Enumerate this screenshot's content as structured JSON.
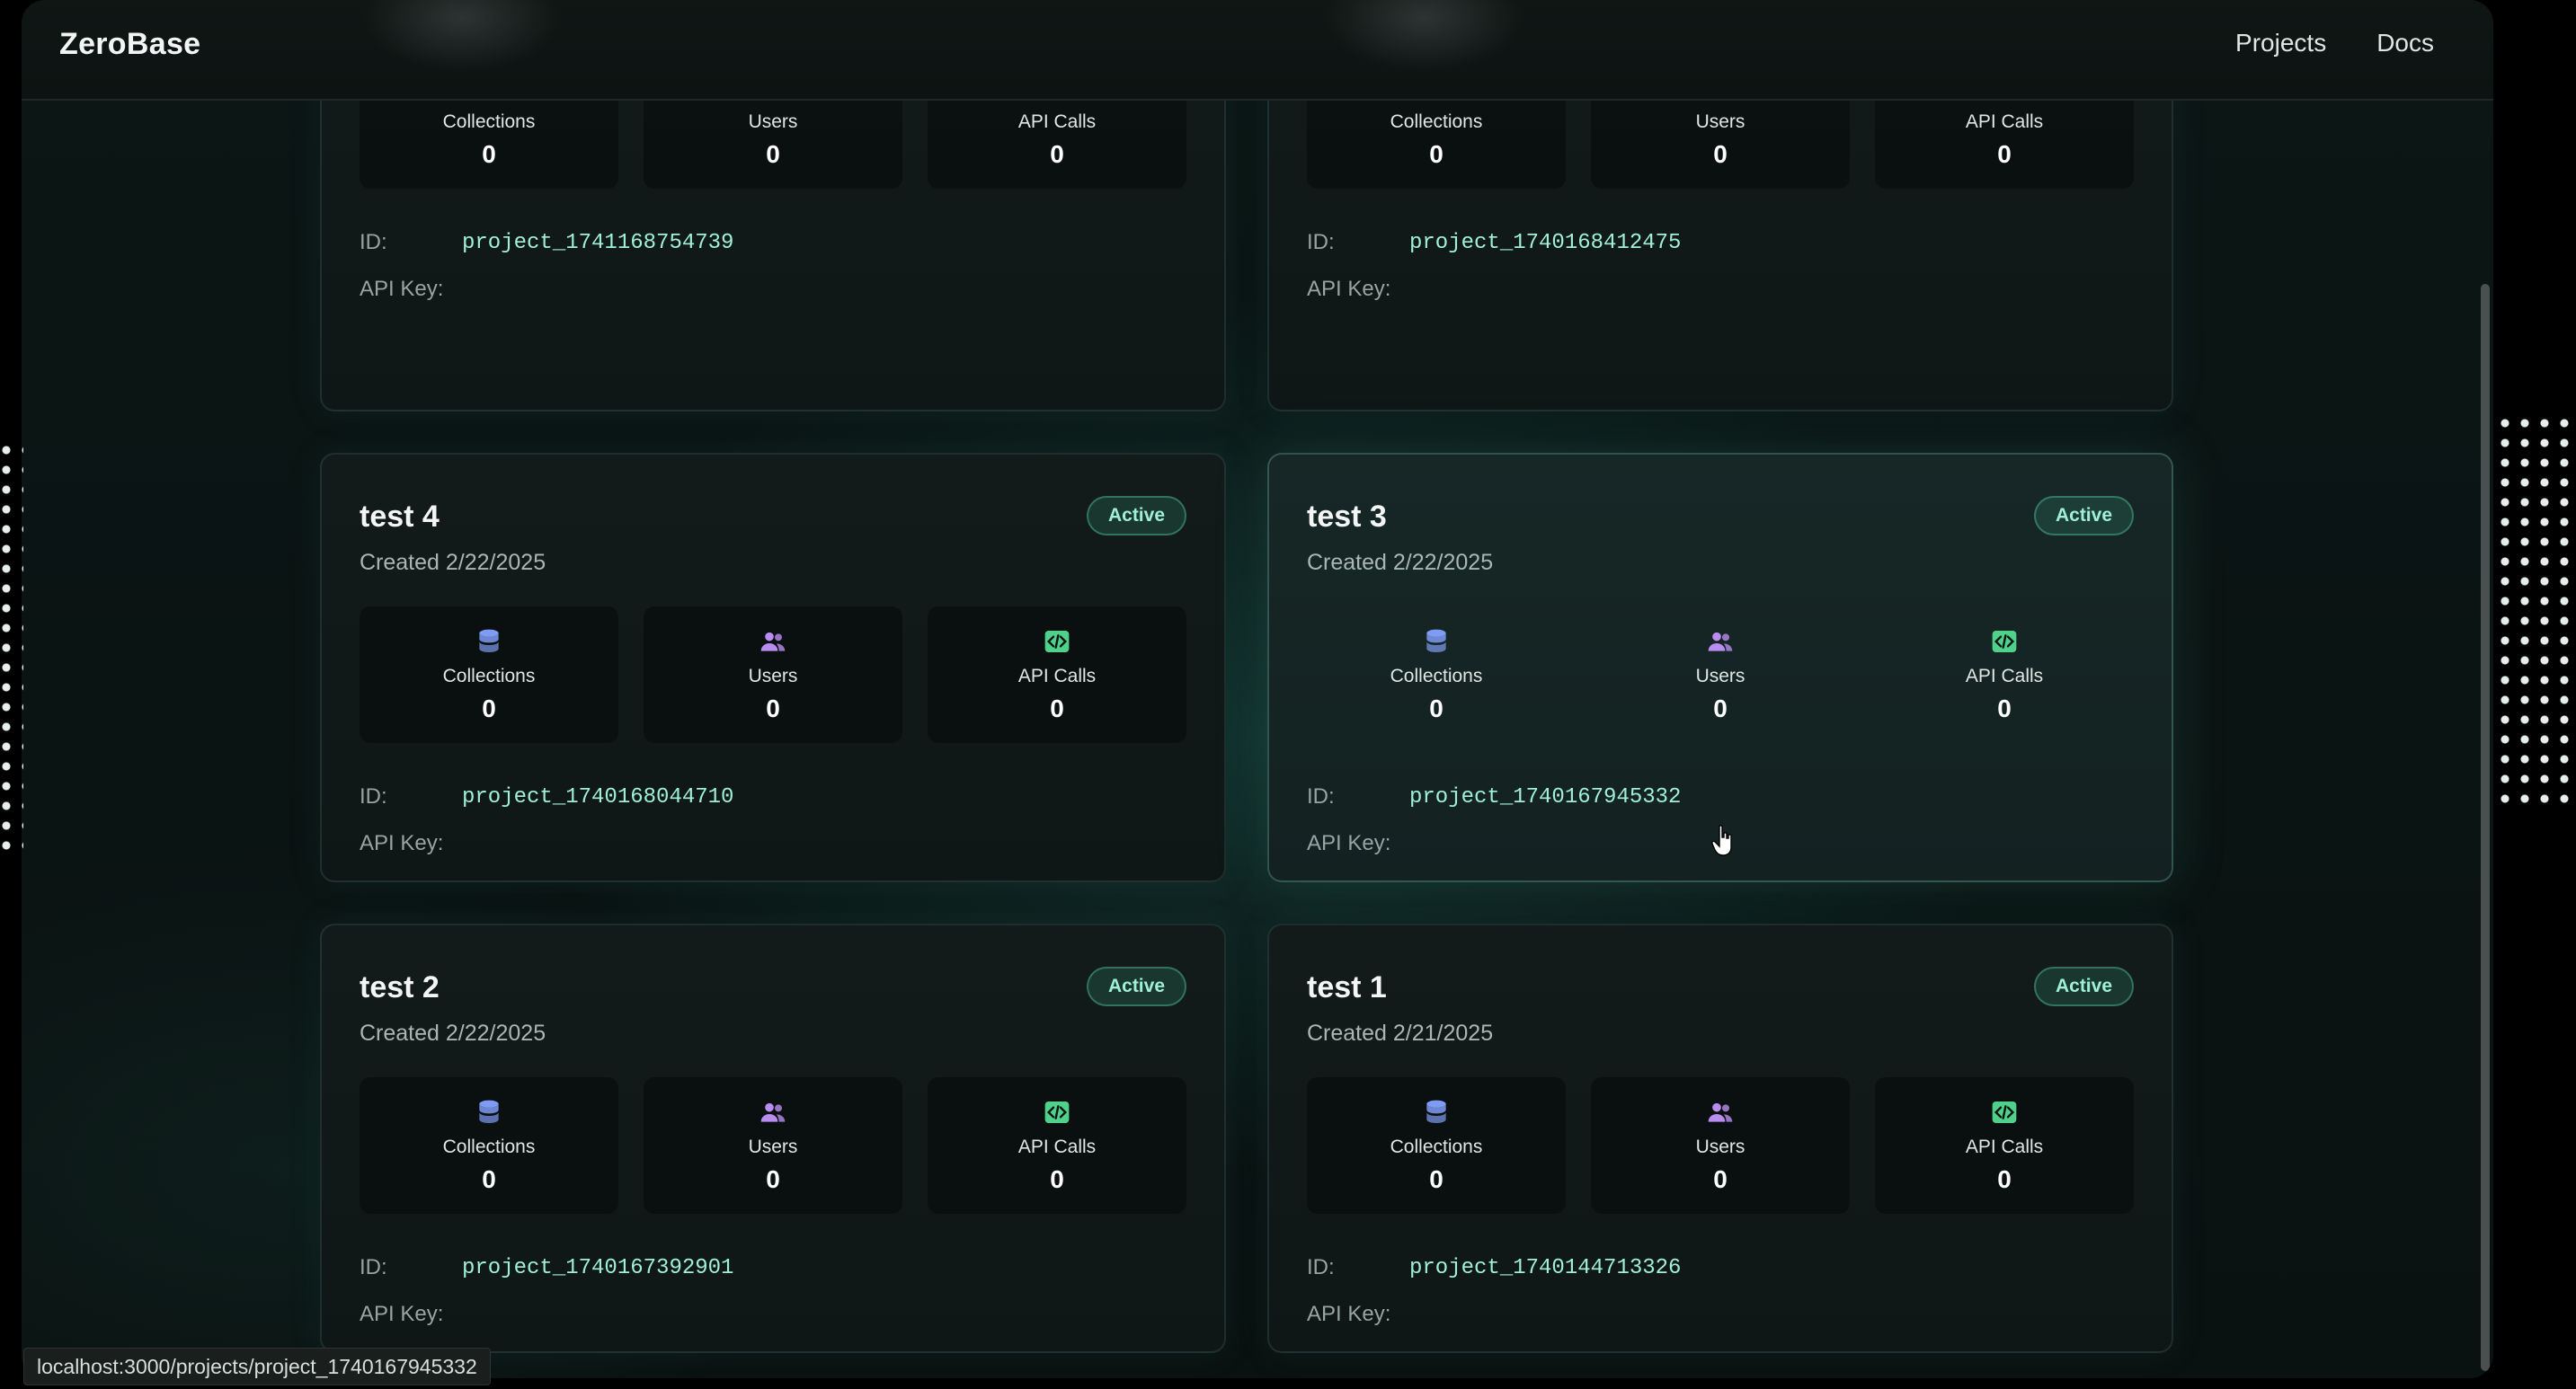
{
  "app": {
    "brand": "ZeroBase"
  },
  "nav": {
    "links": [
      "Projects",
      "Docs"
    ]
  },
  "labels": {
    "collections": "Collections",
    "users": "Users",
    "api_calls": "API Calls",
    "id": "ID:",
    "api_key": "API Key:"
  },
  "cards": [
    {
      "title": "",
      "created": "",
      "badge": "",
      "collections": "0",
      "users": "0",
      "api_calls": "0",
      "id": "project_1741168754739"
    },
    {
      "title": "",
      "created": "",
      "badge": "",
      "collections": "0",
      "users": "0",
      "api_calls": "0",
      "id": "project_1740168412475"
    },
    {
      "title": "test 4",
      "created": "Created 2/22/2025",
      "badge": "Active",
      "collections": "0",
      "users": "0",
      "api_calls": "0",
      "id": "project_1740168044710"
    },
    {
      "title": "test 3",
      "created": "Created 2/22/2025",
      "badge": "Active",
      "collections": "0",
      "users": "0",
      "api_calls": "0",
      "id": "project_1740167945332"
    },
    {
      "title": "test 2",
      "created": "Created 2/22/2025",
      "badge": "Active",
      "collections": "0",
      "users": "0",
      "api_calls": "0",
      "id": "project_1740167392901"
    },
    {
      "title": "test 1",
      "created": "Created 2/21/2025",
      "badge": "Active",
      "collections": "0",
      "users": "0",
      "api_calls": "0",
      "id": "project_1740144713326"
    }
  ],
  "status_bar": {
    "url": "localhost:3000/projects/project_1740167945332"
  },
  "colors": {
    "accent": "#9ff0d6",
    "collections_icon": "#7f9cf5",
    "users_icon": "#b98cf0",
    "api_icon": "#4fd18b"
  },
  "icons": {
    "collections": "database-icon",
    "users": "users-icon",
    "api_calls": "code-icon"
  }
}
